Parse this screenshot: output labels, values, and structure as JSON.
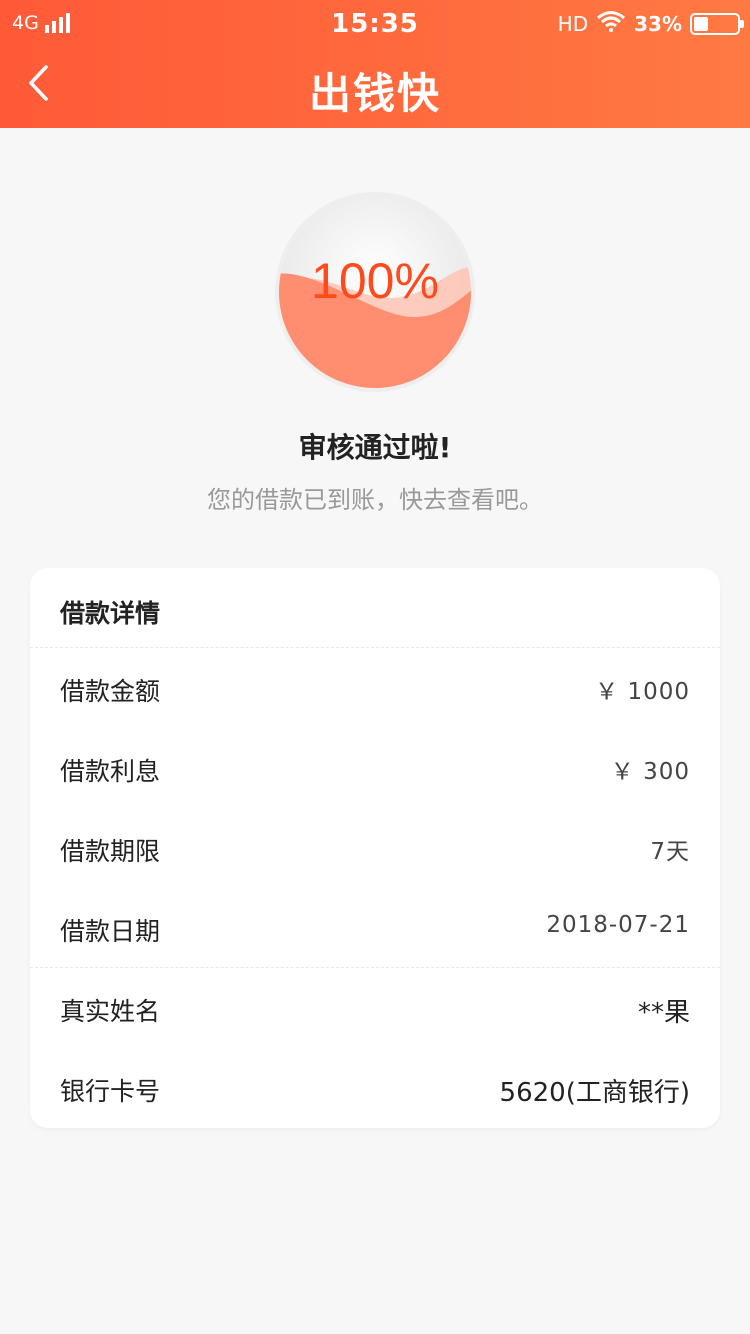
{
  "status_bar": {
    "network": "4G",
    "time": "15:35",
    "hd": "HD",
    "battery_percent": "33%",
    "battery_level": 0.33
  },
  "nav": {
    "title": "出钱快",
    "back_icon": "chevron-left-icon"
  },
  "progress": {
    "value": 1.0,
    "label": "100%"
  },
  "result": {
    "title": "审核通过啦!",
    "subtitle": "您的借款已到账，快去查看吧。"
  },
  "details": {
    "title": "借款详情",
    "rows": [
      {
        "label": "借款金额",
        "value": "￥ 1000"
      },
      {
        "label": "借款利息",
        "value": "￥ 300"
      },
      {
        "label": "借款期限",
        "value": "7天"
      },
      {
        "label": "借款日期",
        "value": "2018-07-21"
      },
      {
        "label": "真实姓名",
        "value": "**果"
      },
      {
        "label": "银行卡号",
        "value": "5620(工商银行)"
      }
    ]
  },
  "colors": {
    "brand": "#ff5a38",
    "accent": "#ff4a1c",
    "wave": "#ff8a6a"
  }
}
